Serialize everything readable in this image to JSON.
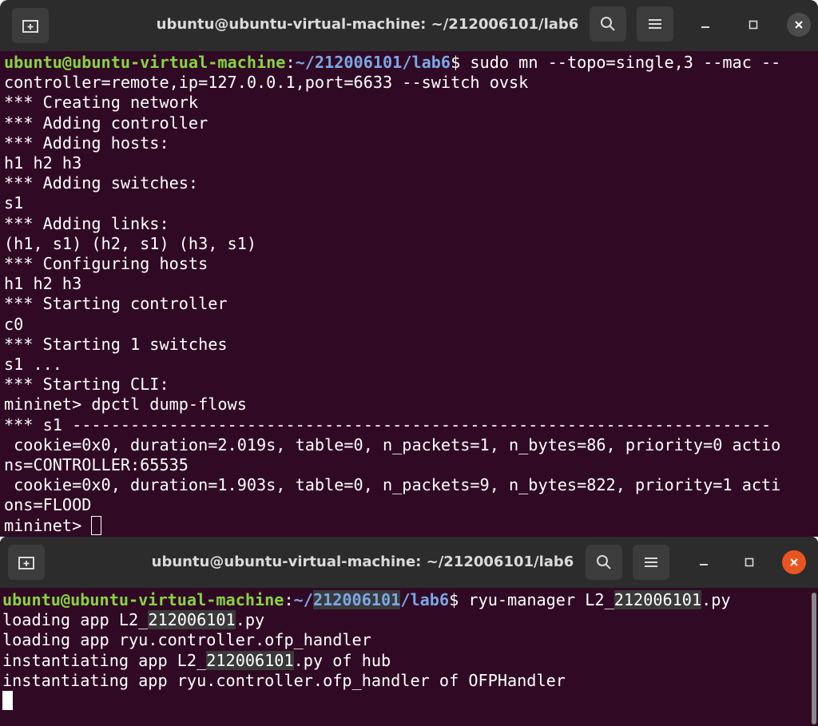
{
  "window_top": {
    "title": "ubuntu@ubuntu-virtual-machine: ~/212006101/lab6",
    "buttons": {
      "new_tab": "new-tab",
      "search": "search",
      "menu": "menu",
      "minimize": "minimize",
      "maximize": "maximize",
      "close": "close"
    },
    "prompt_user": "ubuntu@ubuntu-virtual-machine",
    "prompt_sep": ":",
    "prompt_path": "~/212006101/lab6",
    "prompt_dollar": "$",
    "command_part1": " sudo mn --topo=single,3 --mac --",
    "command_part2": "controller=remote,ip=127.0.0.1,port=6633 --switch ovsk",
    "output_lines": [
      "*** Creating network",
      "*** Adding controller",
      "*** Adding hosts:",
      "h1 h2 h3",
      "*** Adding switches:",
      "s1",
      "*** Adding links:",
      "(h1, s1) (h2, s1) (h3, s1)",
      "*** Configuring hosts",
      "h1 h2 h3",
      "*** Starting controller",
      "c0",
      "*** Starting 1 switches",
      "s1 ...",
      "*** Starting CLI:",
      "mininet> dpctl dump-flows",
      "*** s1 ------------------------------------------------------------------------",
      " cookie=0x0, duration=2.019s, table=0, n_packets=1, n_bytes=86, priority=0 actio",
      "ns=CONTROLLER:65535",
      " cookie=0x0, duration=1.903s, table=0, n_packets=9, n_bytes=822, priority=1 acti",
      "ons=FLOOD"
    ],
    "final_prompt": "mininet> "
  },
  "window_bottom": {
    "title": "ubuntu@ubuntu-virtual-machine: ~/212006101/lab6",
    "prompt_user": "ubuntu@ubuntu-virtual-machine",
    "prompt_sep": ":",
    "prompt_path_a": "~/",
    "prompt_path_b": "212006101",
    "prompt_path_c": "/lab6",
    "prompt_dollar": "$",
    "command_a": " ryu-manager L2_",
    "command_b": "212006101",
    "command_c": ".py",
    "line1_a": "loading app L2_",
    "line1_b": "212006101",
    "line1_c": ".py",
    "line2": "loading app ryu.controller.ofp_handler",
    "line3_a": "instantiating app L2_",
    "line3_b": "212006101",
    "line3_c": ".py of hub",
    "line4": "instantiating app ryu.controller.ofp_handler of OFPHandler"
  },
  "colors": {
    "terminal_bg": "#300a24",
    "titlebar_bg": "#2c2c2c",
    "prompt_user": "#87d441",
    "prompt_path": "#7aa7e6",
    "close_active": "#e95420"
  }
}
